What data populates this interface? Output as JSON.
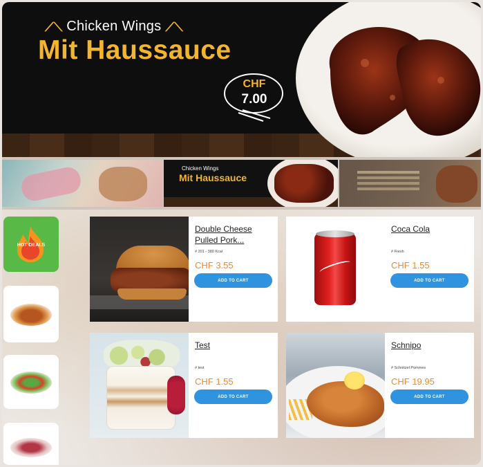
{
  "hero": {
    "subtitle": "Chicken Wings",
    "title": "Mit Haussauce",
    "price_currency": "CHF",
    "price_value": "7.00"
  },
  "carousel": {
    "slide2_subtitle": "Chicken Wings",
    "slide2_title": "Mit Haussauce"
  },
  "categories": [
    {
      "label": "HOT DEALS"
    }
  ],
  "products": [
    {
      "title": "Double Cheese Pulled Pork...",
      "meta": "# 201 - 380 Kcal",
      "price": "CHF 3.55",
      "button": "ADD TO CART"
    },
    {
      "title": "Coca Cola",
      "meta": "# Fresh",
      "price": "CHF 1.55",
      "button": "ADD TO CART"
    },
    {
      "title": "Test",
      "meta": "# test",
      "price": "CHF 1.55",
      "button": "ADD TO CART"
    },
    {
      "title": "Schnipo",
      "meta": "# Schnitzel Pommes",
      "price": "CHF 19.95",
      "button": "ADD TO CART"
    }
  ],
  "colors": {
    "accent_yellow": "#f2b531",
    "hot_deals_green": "#58b947",
    "button_blue": "#2f93e0",
    "price_orange": "#f08a2c"
  },
  "icons": {
    "hot_deals": "flame-icon",
    "sparkle": "sparkle-icon"
  }
}
